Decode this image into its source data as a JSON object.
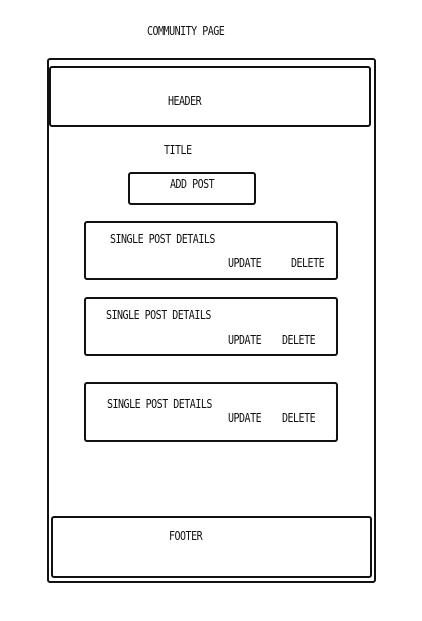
{
  "page_title": "COMMUNITY PAGE",
  "header": {
    "label": "HEADER"
  },
  "title": {
    "label": "TITLE"
  },
  "add_post": {
    "label": "ADD POST"
  },
  "posts": [
    {
      "details": "SINGLE POST DETAILS",
      "update": "UPDATE",
      "delete": "DELETE"
    },
    {
      "details": "SINGLE POST DETAILS",
      "update": "UPDATE",
      "delete": "DELETE"
    },
    {
      "details": "SINGLE POST DETAILS",
      "update": "UPDATE",
      "delete": "DELETE"
    }
  ],
  "footer": {
    "label": "FOOTER"
  }
}
